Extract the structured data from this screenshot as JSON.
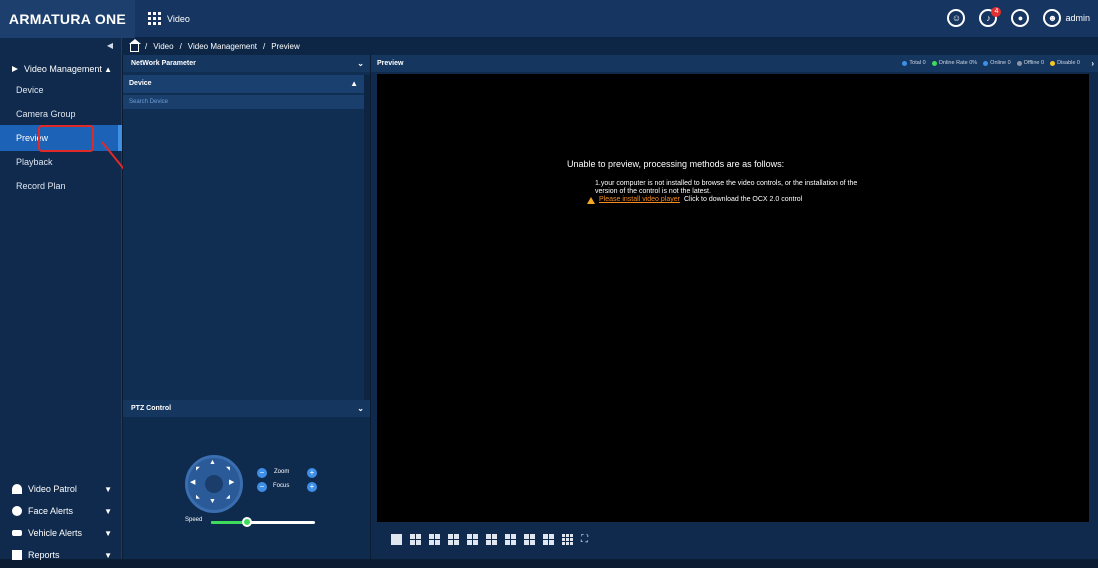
{
  "app": {
    "logo": "ARMATURA ONE",
    "module": "Video",
    "user": "admin",
    "notifications_count": "4"
  },
  "breadcrumb": [
    "Video",
    "Video Management",
    "Preview"
  ],
  "sidebar": {
    "group": "Video Management",
    "items": [
      {
        "label": "Device"
      },
      {
        "label": "Camera Group"
      },
      {
        "label": "Preview"
      },
      {
        "label": "Playback"
      },
      {
        "label": "Record Plan"
      }
    ],
    "bottom_groups": [
      {
        "label": "Video Patrol"
      },
      {
        "label": "Face Alerts"
      },
      {
        "label": "Vehicle Alerts"
      },
      {
        "label": "Reports"
      }
    ]
  },
  "panel": {
    "network_params": "NetWork Parameter",
    "device_header": "Device",
    "search_placeholder": "Search Device",
    "ptz_header": "PTZ Control",
    "zoom_label": "Zoom",
    "focus_label": "Focus",
    "speed_label": "Speed",
    "speed_value": 0.35
  },
  "preview": {
    "title": "Preview",
    "stats": {
      "total": "Total 0",
      "online_rate": "Online Rate 0%",
      "online": "Online 0",
      "offline": "Offline 0",
      "disable": "Disable 0"
    },
    "colors": {
      "total": "#3e8fe6",
      "online_rate": "#3ddc5a",
      "online": "#3e8fe6",
      "offline": "#8a96a8",
      "disable": "#f5c823"
    },
    "message_title": "Unable to preview, processing methods are as follows:",
    "message_line1": "1.your computer is not installed to browse the video controls, or the installation of the",
    "message_line2": "version of the control is not the latest.",
    "link_text": "Please install video player",
    "link_suffix": "Click to download the OCX 2.0 control"
  }
}
